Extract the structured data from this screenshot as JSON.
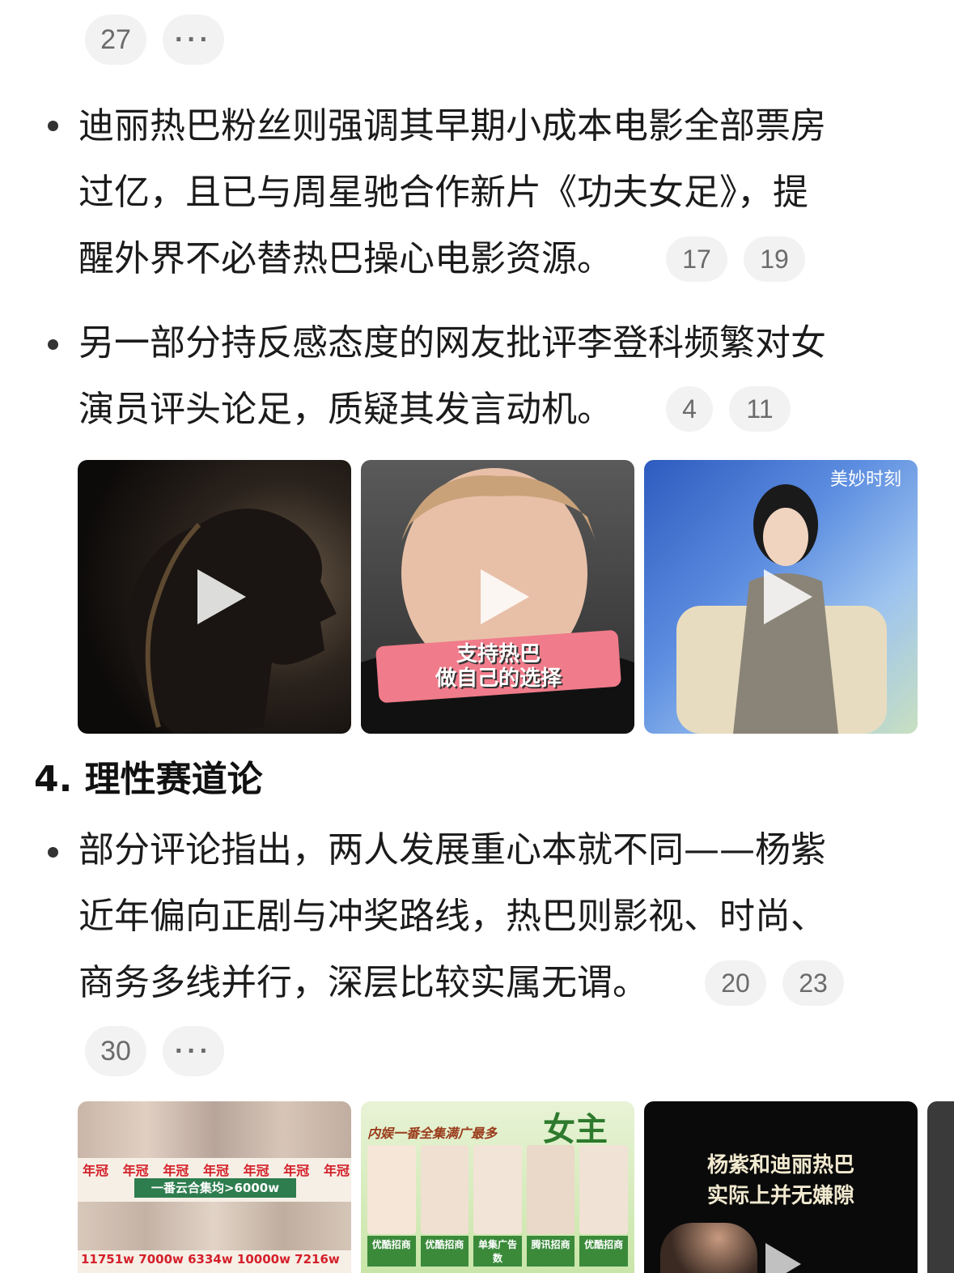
{
  "top_counters": {
    "count": "27",
    "more": "···"
  },
  "bullets": [
    {
      "lines": [
        "迪丽热巴粉丝则强调其早期小成本电影全部票房",
        "过亿，且已与周星驰合作新片《功夫女足》，提",
        "醒外界不必替热巴操心电影资源。"
      ],
      "refs": [
        "17",
        "19"
      ]
    },
    {
      "lines": [
        "另一部分持反感态度的网友批评李登科频繁对女",
        "演员评头论足，质疑其发言动机。"
      ],
      "refs": [
        "4",
        "11"
      ]
    }
  ],
  "video_row_1": [
    {
      "icon": "play-icon",
      "caption": ""
    },
    {
      "icon": "play-icon",
      "caption": "支持热巴\n做自己的选择"
    },
    {
      "icon": "play-icon",
      "caption": "美妙时刻"
    }
  ],
  "section": {
    "number": "4.",
    "title": "理性赛道论"
  },
  "bullet3": {
    "lines": [
      "部分评论指出，两人发展重心本就不同——杨紫",
      "近年偏向正剧与冲奖路线，热巴则影视、时尚、",
      "商务多线并行，深层比较实属无谓。"
    ],
    "refs": [
      "20",
      "23"
    ]
  },
  "bottom_counters": {
    "count": "30",
    "more": "···"
  },
  "image_row_2": {
    "tile1": {
      "badges": [
        "年冠",
        "年冠",
        "年冠",
        "年冠",
        "年冠",
        "年冠",
        "年冠"
      ],
      "middle": "一番云合集均>6000w",
      "bottom": "11751w 7000w 6334w 10000w 7216w"
    },
    "tile2": {
      "header": "内娱一番全集满广最多",
      "corner": "女主",
      "tags": [
        "优酷招商",
        "优酷招商",
        "单集广告数",
        "腾讯招商",
        "优酷招商"
      ]
    },
    "tile3": {
      "caption1": "杨紫和迪丽热巴",
      "caption2": "实际上并无嫌隙"
    }
  },
  "colors": {
    "pill_bg": "#f2f2f2",
    "pill_text": "#6b6b6b",
    "text": "#1b1b1b",
    "caption_red": "#d4202a",
    "caption_pink": "#f07b8a"
  }
}
